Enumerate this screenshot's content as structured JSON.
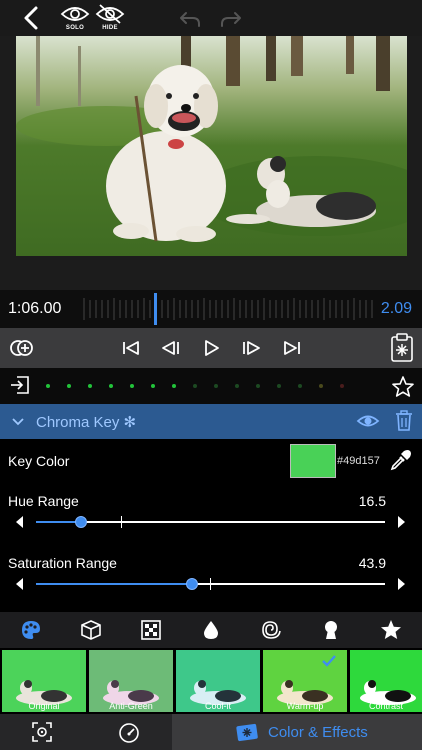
{
  "toolbar": {
    "solo_label": "SOLO",
    "hide_label": "HIDE"
  },
  "timeline": {
    "timecode": "1:06.00",
    "duration": "2.09"
  },
  "effect": {
    "title": "Chroma Key ✻"
  },
  "key_color": {
    "label": "Key Color",
    "hex": "#49d157",
    "swatch_color": "#49d157"
  },
  "hue_range": {
    "label": "Hue Range",
    "value": "16.5"
  },
  "saturation_range": {
    "label": "Saturation Range",
    "value": "43.9"
  },
  "categories": [
    "palette-icon",
    "cube-icon",
    "grid-icon",
    "drop-icon",
    "spiral-icon",
    "keyhole-icon",
    "star-icon"
  ],
  "presets": [
    {
      "label": "Original"
    },
    {
      "label": "Anti-Green"
    },
    {
      "label": "Cool-it"
    },
    {
      "label": "Warm-up",
      "selected": true
    },
    {
      "label": "Contrast"
    }
  ],
  "tabs": {
    "color_effects_label": "Color & Effects"
  },
  "colors": {
    "accent": "#3f8df0",
    "effect_header": "#2c5a91"
  }
}
